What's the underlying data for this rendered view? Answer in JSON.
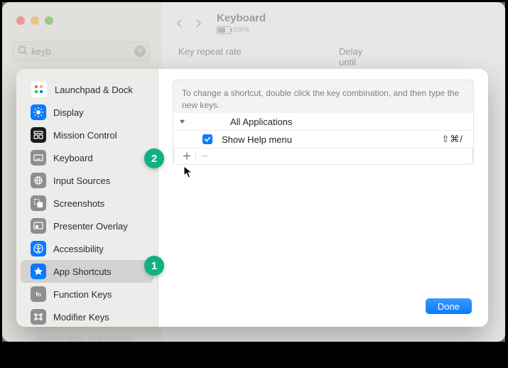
{
  "bg": {
    "title": "Keyboard",
    "battery_pct": "59%",
    "label_repeat": "Key repeat rate",
    "label_delay": "Delay until repeat",
    "search_value": "keyb",
    "ghost": "Appearance (Keyboard)"
  },
  "sidebar": {
    "items": [
      {
        "label": "Launchpad & Dock"
      },
      {
        "label": "Display"
      },
      {
        "label": "Mission Control"
      },
      {
        "label": "Keyboard"
      },
      {
        "label": "Input Sources"
      },
      {
        "label": "Screenshots"
      },
      {
        "label": "Presenter Overlay"
      },
      {
        "label": "Accessibility"
      },
      {
        "label": "App Shortcuts"
      },
      {
        "label": "Function Keys"
      },
      {
        "label": "Modifier Keys"
      }
    ]
  },
  "main": {
    "info": "To change a shortcut, double click the key combination, and then type the new keys.",
    "group": "All Applications",
    "entry_label": "Show Help menu",
    "entry_shortcut": "⇧⌘/",
    "done": "Done"
  },
  "annotations": {
    "b1": "1",
    "b2": "2"
  }
}
